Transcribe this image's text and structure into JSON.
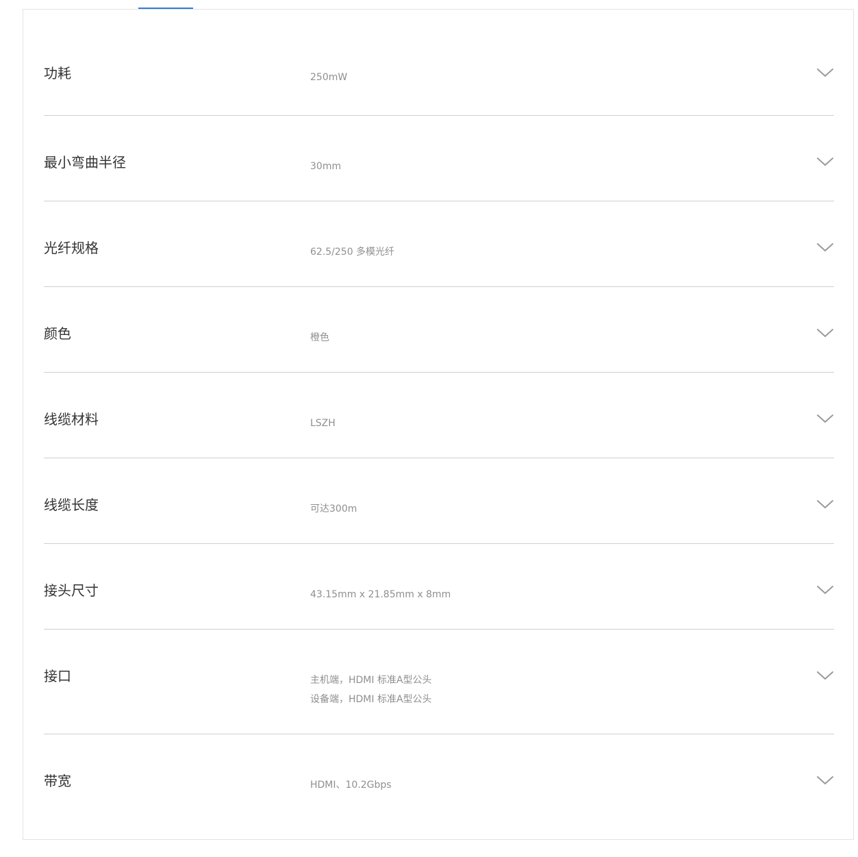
{
  "specs": [
    {
      "label": "功耗",
      "values": [
        "250mW"
      ]
    },
    {
      "label": "最小弯曲半径",
      "values": [
        "30mm"
      ]
    },
    {
      "label": "光纤规格",
      "values": [
        "62.5/250 多模光纤"
      ]
    },
    {
      "label": "颜色",
      "values": [
        "橙色"
      ]
    },
    {
      "label": "线缆材料",
      "values": [
        "LSZH"
      ]
    },
    {
      "label": "线缆长度",
      "values": [
        "可达300m"
      ]
    },
    {
      "label": "接头尺寸",
      "values": [
        "43.15mm x 21.85mm x 8mm"
      ]
    },
    {
      "label": "接口",
      "values": [
        "主机端，HDMI 标准A型公头",
        "设备端，HDMI 标准A型公头"
      ]
    },
    {
      "label": "带宽",
      "values": [
        "HDMI、10.2Gbps"
      ]
    }
  ],
  "icons": {
    "expand": "chevron-down-icon"
  },
  "colors": {
    "tab_indicator": "#2b7fd6",
    "divider": "#cfcfcf",
    "label": "#333333",
    "value": "#8f8f8f",
    "chevron": "#9a9a9a"
  }
}
